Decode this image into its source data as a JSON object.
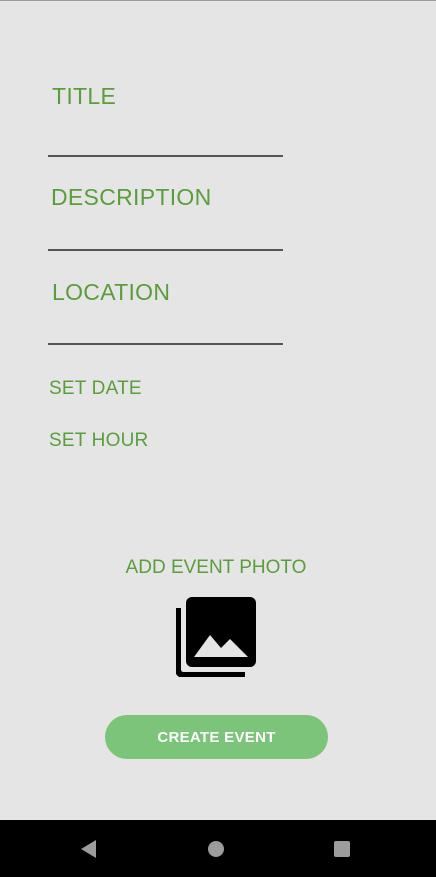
{
  "form": {
    "title_label": "TITLE",
    "description_label": "DESCRIPTION",
    "location_label": "LOCATION",
    "set_date_label": "SET DATE",
    "set_hour_label": "SET HOUR"
  },
  "photo": {
    "label": "ADD EVENT PHOTO",
    "icon": "photo-library-icon"
  },
  "actions": {
    "create_label": "CREATE EVENT"
  },
  "navigation": {
    "back_icon": "back-icon",
    "home_icon": "home-icon",
    "recents_icon": "recents-icon"
  },
  "colors": {
    "background": "#e5e5e5",
    "accent_text": "#5a9e3c",
    "button_fill": "#7cc47a",
    "nav_bar": "#000000"
  }
}
